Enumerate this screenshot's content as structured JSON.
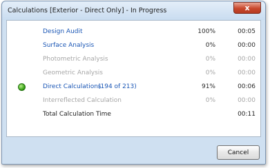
{
  "window": {
    "title": "Calculations [Exterior - Direct Only] - In Progress",
    "close_label": "x"
  },
  "rows": [
    {
      "label": "Design Audit",
      "count": "",
      "percent": "100%",
      "time": "00:05",
      "state": "link",
      "icon": ""
    },
    {
      "label": "Surface Analysis",
      "count": "",
      "percent": "0%",
      "time": "00:00",
      "state": "link",
      "icon": ""
    },
    {
      "label": "Photometric Analysis",
      "count": "",
      "percent": "0%",
      "time": "00:00",
      "state": "disabled",
      "icon": ""
    },
    {
      "label": "Geometric Analysis",
      "count": "",
      "percent": "0%",
      "time": "00:00",
      "state": "disabled",
      "icon": ""
    },
    {
      "label": "Direct Calculations",
      "count": "(194 of 213)",
      "percent": "91%",
      "time": "00:06",
      "state": "link",
      "icon": "green-status-icon"
    },
    {
      "label": "Interreflected Calculation",
      "count": "",
      "percent": "0%",
      "time": "00:00",
      "state": "disabled",
      "icon": ""
    }
  ],
  "total": {
    "label": "Total Calculation Time",
    "time": "00:11"
  },
  "footer": {
    "cancel_label": "Cancel"
  },
  "colors": {
    "link": "#1a56b5",
    "disabled": "#a6a6a6",
    "close_button": "#c9482d",
    "status_green": "#3ea51c"
  }
}
